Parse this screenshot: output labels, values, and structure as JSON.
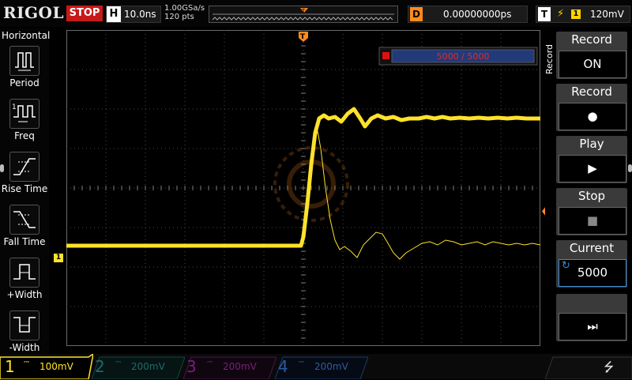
{
  "topbar": {
    "brand": "RIGOL",
    "run_state": "STOP",
    "horizontal": {
      "tag": "H",
      "timebase": "10.0ns"
    },
    "sample_rate": "1.00GSa/s",
    "memory_depth": "120 pts",
    "trigger_marker": "T",
    "delay": {
      "tag": "D",
      "value": "0.00000000ps"
    },
    "trigger": {
      "tag": "T",
      "edge": "⚡",
      "channel": "1",
      "level": "120mV"
    }
  },
  "left_menu": {
    "title": "Horizontal",
    "items": [
      {
        "label": "Period",
        "icon": "period-icon"
      },
      {
        "label": "Freq",
        "icon": "frequency-icon"
      },
      {
        "label": "Rise Time",
        "icon": "rise-time-icon"
      },
      {
        "label": "Fall Time",
        "icon": "fall-time-icon"
      },
      {
        "label": "+Width",
        "icon": "positive-width-icon"
      },
      {
        "label": "-Width",
        "icon": "negative-width-icon"
      }
    ]
  },
  "screen": {
    "trigger_pos_marker": "T",
    "trigger_level_marker": "T",
    "channel_marker": "1",
    "frame_counter": "5000 / 5000",
    "colors": {
      "ch1": "#ffe22a",
      "trigger": "#ff8a1c",
      "grid": "#5a5a5a",
      "record_red": "#e01010",
      "counter_bar": "#233a7a"
    }
  },
  "right_menu": {
    "title": "Record",
    "buttons": [
      {
        "label": "Record",
        "value": "ON"
      },
      {
        "label": "Record",
        "value": "●"
      },
      {
        "label": "Play",
        "value": "▶"
      },
      {
        "label": "Stop",
        "value": "■"
      },
      {
        "label": "Current",
        "value": "5000",
        "icon": "↻"
      },
      {
        "label": "",
        "value": "⏭"
      }
    ]
  },
  "channels": [
    {
      "num": "1",
      "scale": "100mV",
      "color": "#ffe22a",
      "active": true
    },
    {
      "num": "2",
      "scale": "200mV",
      "color": "#22a5a5",
      "active": false
    },
    {
      "num": "3",
      "scale": "200mV",
      "color": "#c020c0",
      "active": false
    },
    {
      "num": "4",
      "scale": "200mV",
      "color": "#2a6ad8",
      "active": false
    }
  ],
  "status": {
    "usb_icon": "⭍"
  }
}
